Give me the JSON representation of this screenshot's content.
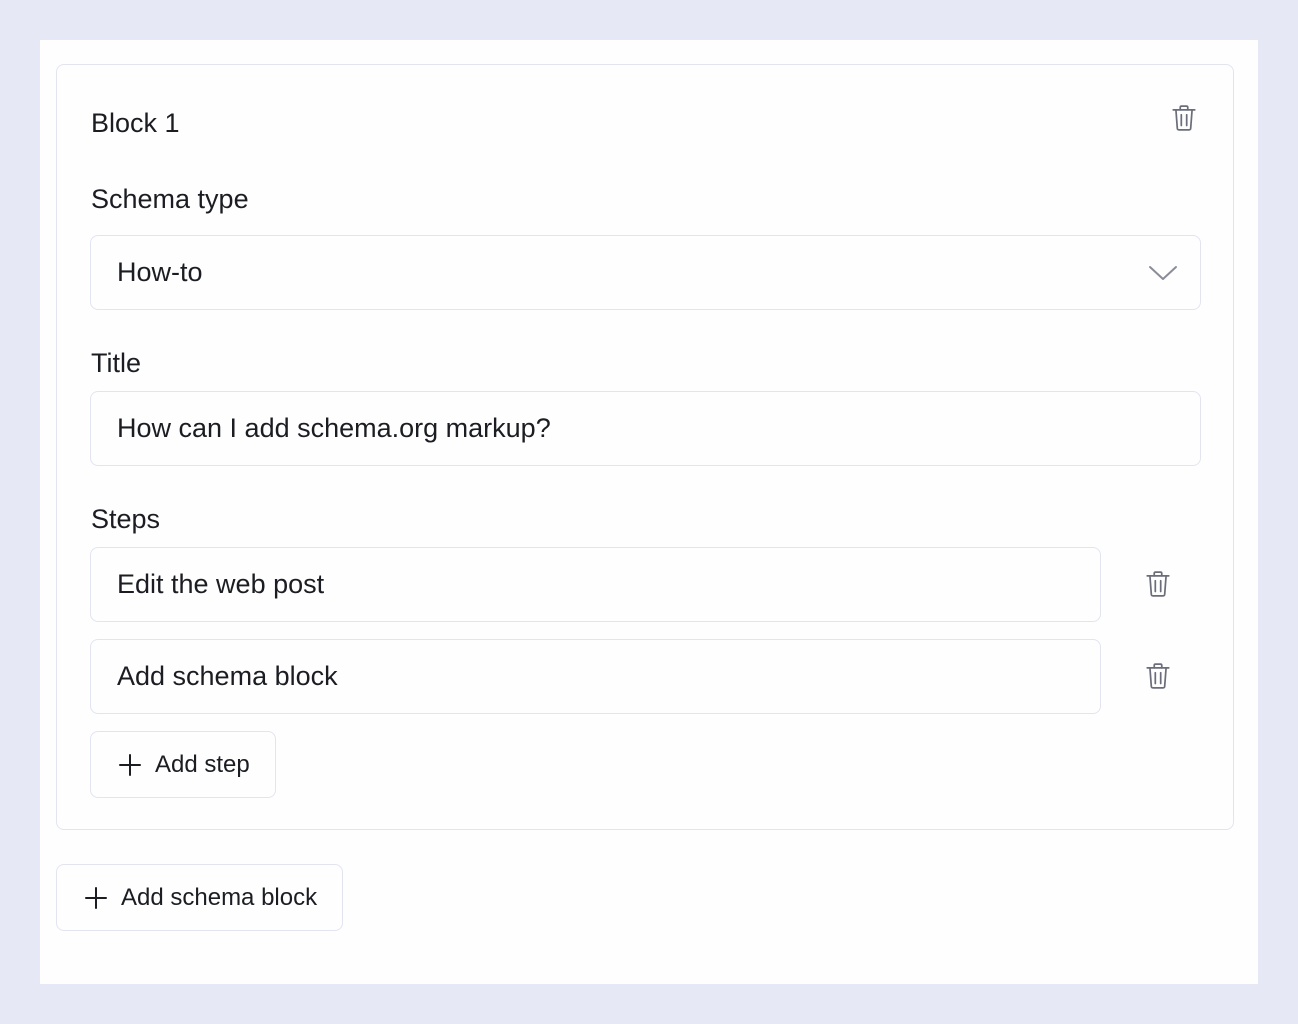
{
  "block": {
    "title": "Block 1",
    "schema_type": {
      "label": "Schema type",
      "value": "How-to"
    },
    "title_field": {
      "label": "Title",
      "value": "How can I add schema.org markup?"
    },
    "steps": {
      "label": "Steps",
      "items": [
        {
          "value": "Edit the web post"
        },
        {
          "value": "Add schema block"
        }
      ],
      "add_label": "Add step"
    }
  },
  "add_block_label": "Add schema block",
  "icons": {
    "delete": "trash-icon",
    "dropdown": "chevron-down-icon",
    "add": "plus-icon"
  },
  "colors": {
    "background": "#e6e8f6",
    "panel": "#fefeff",
    "border": "#e2e4f0",
    "text": "#1b1d22",
    "icon": "#6b6e7a"
  }
}
